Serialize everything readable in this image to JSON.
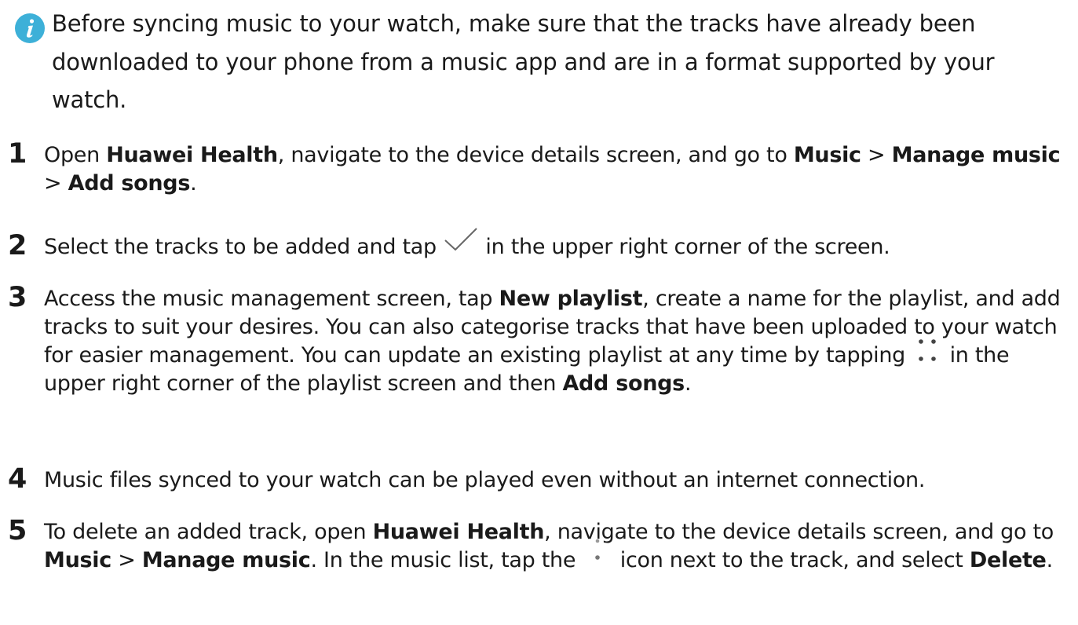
{
  "note": {
    "icon": "info-icon",
    "icon_color": "#3db0d8",
    "text": "Before syncing music to your watch, make sure that the tracks have already been downloaded to your phone from a music app and are in a format supported by your watch."
  },
  "steps": [
    {
      "num": "1",
      "parts": {
        "t1": "Open ",
        "b1": "Huawei Health",
        "t2": ", navigate to the device details screen, and go to ",
        "b2": "Music",
        "t3": " > ",
        "b3": "Manage music",
        "t4": " > ",
        "b4": "Add songs",
        "t5": "."
      }
    },
    {
      "num": "2",
      "parts": {
        "t1": "Select the tracks to be added and tap ",
        "icon": "checkmark-icon",
        "t2": " in the upper right corner of the screen."
      }
    },
    {
      "num": "3",
      "parts": {
        "t1": "Access the music management screen, tap ",
        "b1": "New playlist",
        "t2": ", create a name for the playlist, and add tracks to suit your desires. You can also categorise tracks that have been uploaded to your watch for easier management. You can update an existing playlist at any time by tapping ",
        "icon": "more-dots-icon",
        "t3": " in the upper right corner of the playlist screen and then ",
        "b2": "Add songs",
        "t4": "."
      }
    },
    {
      "num": "4",
      "parts": {
        "t1": "Music files synced to your watch can be played even without an internet connection."
      }
    },
    {
      "num": "5",
      "parts": {
        "t1": "To delete an added track, open ",
        "b1": "Huawei Health",
        "t2": ", navigate to the device details screen, and go to ",
        "b2": "Music",
        "t3": " > ",
        "b3": "Manage music",
        "t4": ". In the music list, tap the ",
        "icon": "vertical-dots-icon",
        "t5": " icon next to the track, and select ",
        "b4": "Delete",
        "t6": "."
      }
    }
  ]
}
